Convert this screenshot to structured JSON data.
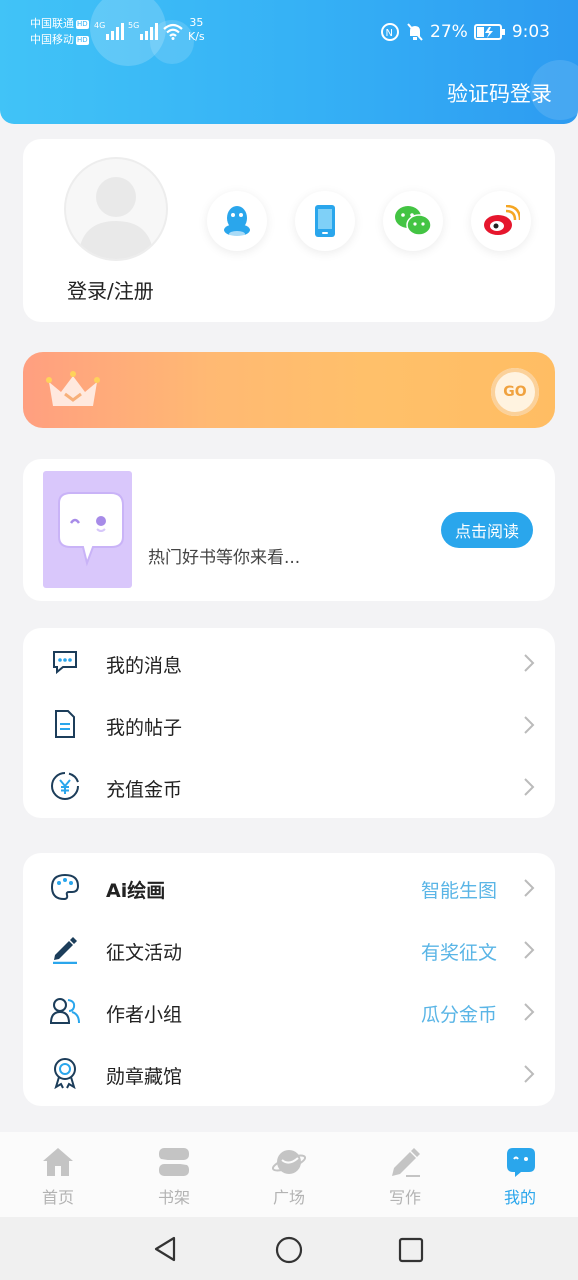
{
  "status_bar": {
    "carrier1": "中国联通",
    "carrier2": "中国移动",
    "hd": "HD",
    "net1": "4G",
    "net2": "5G",
    "speed_value": "35",
    "speed_unit": "K/s",
    "battery": "27%",
    "time": "9:03"
  },
  "header": {
    "login_code": "验证码登录"
  },
  "profile": {
    "login_label": "登录/注册",
    "social": [
      "qq-icon",
      "phone-icon",
      "wechat-icon",
      "weibo-icon"
    ]
  },
  "vip": {
    "go_label": "GO"
  },
  "book": {
    "description": "热门好书等你来看...",
    "read_button": "点击阅读"
  },
  "menu1": [
    {
      "label": "我的消息",
      "icon": "message-icon"
    },
    {
      "label": "我的帖子",
      "icon": "document-icon"
    },
    {
      "label": "充值金币",
      "icon": "coin-icon"
    }
  ],
  "menu2": [
    {
      "label": "Ai绘画",
      "extra": "智能生图",
      "icon": "palette-icon"
    },
    {
      "label": "征文活动",
      "extra": "有奖征文",
      "icon": "pen-icon"
    },
    {
      "label": "作者小组",
      "extra": "瓜分金币",
      "icon": "group-icon"
    },
    {
      "label": "勋章藏馆",
      "extra": "",
      "icon": "medal-icon"
    }
  ],
  "tabs": [
    {
      "label": "首页",
      "icon": "home-icon",
      "active": false
    },
    {
      "label": "书架",
      "icon": "bookshelf-icon",
      "active": false
    },
    {
      "label": "广场",
      "icon": "planet-icon",
      "active": false
    },
    {
      "label": "写作",
      "icon": "write-icon",
      "active": false
    },
    {
      "label": "我的",
      "icon": "mine-icon",
      "active": true
    }
  ],
  "colors": {
    "header_start": "#41c3f7",
    "header_end": "#2d9bf1",
    "accent": "#2aa6ec",
    "extra_text": "#5ab5e6",
    "vip_start": "#ff9f80",
    "vip_end": "#ffbd63"
  }
}
